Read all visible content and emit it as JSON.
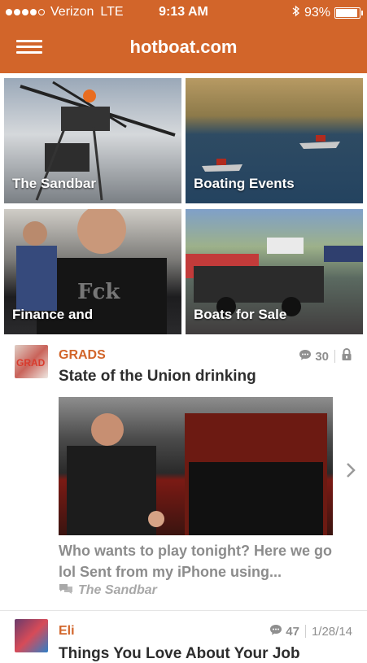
{
  "status_bar": {
    "carrier": "Verizon",
    "network": "LTE",
    "time": "9:13 AM",
    "battery": "93%",
    "signal_bars": 4
  },
  "header": {
    "title": "hotboat.com",
    "menu_icon": "hamburger-menu-icon",
    "background": "#d2652a"
  },
  "tiles": [
    {
      "label": "The Sandbar"
    },
    {
      "label": "Boating Events"
    },
    {
      "label": "Finance and"
    },
    {
      "label": "Boats for Sale"
    }
  ],
  "posts": [
    {
      "author": "GRADS",
      "comments": "30",
      "title": "State of the Union drinking",
      "excerpt": "Who wants to play tonight? Here we go lol Sent from my iPhone using...",
      "category": "The Sandbar",
      "avatar_text": "GRAD"
    },
    {
      "author": "Eli",
      "comments": "47",
      "date": "1/28/14",
      "title": "Things You Love About Your Job"
    }
  ],
  "accent_color": "#d2652a"
}
